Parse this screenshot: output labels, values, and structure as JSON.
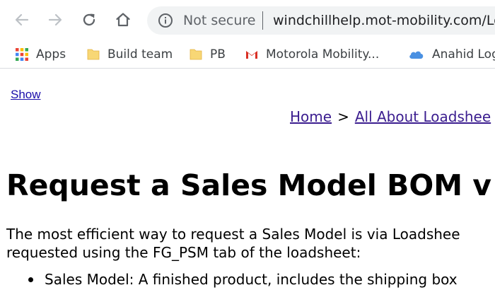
{
  "toolbar": {
    "not_secure_label": "Not secure",
    "url": "windchillhelp.mot-mobility.com/Lo"
  },
  "bookmarks": [
    {
      "label": "Apps",
      "icon": "apps-grid-icon"
    },
    {
      "label": "Build team",
      "icon": "folder-icon"
    },
    {
      "label": "PB",
      "icon": "folder-icon"
    },
    {
      "label": "Motorola Mobility...",
      "icon": "gmail-icon"
    },
    {
      "label": "Anahid Log",
      "icon": "cloud-icon"
    }
  ],
  "page": {
    "show_link": "Show",
    "breadcrumb": {
      "home": "Home",
      "separator": ">",
      "current": "All About Loadshee"
    },
    "title": "Request a Sales Model BOM v",
    "paragraph_line1": "The most efficient way to request a Sales Model is via Loadshee",
    "paragraph_line2": "requested using the FG_PSM tab of the loadsheet:",
    "bullets": [
      "Sales Model: A finished product, includes the shipping box"
    ]
  },
  "colors": {
    "link": "#1a0daa",
    "visited_link": "#3b1d8f",
    "omnibox_bg": "#f1f3f4",
    "folder": "#f8d775"
  }
}
